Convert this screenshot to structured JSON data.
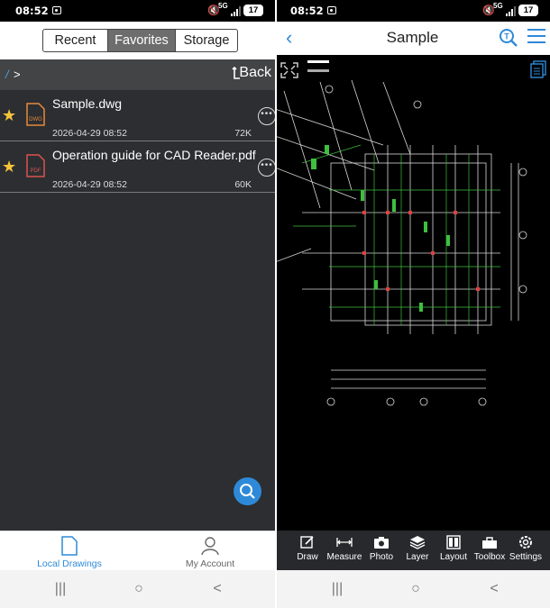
{
  "status": {
    "time": "08:52",
    "network": "5G",
    "battery": "17"
  },
  "left": {
    "tabs": {
      "recent": "Recent",
      "favorites": "Favorites",
      "storage": "Storage"
    },
    "path": {
      "root": "/",
      "separator": ">",
      "back": "Back"
    },
    "files": [
      {
        "name": "Sample.dwg",
        "date": "2026-04-29 08:52",
        "size": "72K",
        "type": "DWG"
      },
      {
        "name": "Operation guide for CAD Reader.pdf",
        "date": "2026-04-29 08:52",
        "size": "60K",
        "type": "PDF"
      }
    ],
    "bottom": {
      "local": "Local Drawings",
      "account": "My Account"
    }
  },
  "right": {
    "title": "Sample",
    "toolbar": [
      "Draw",
      "Measure",
      "Photo",
      "Layer",
      "Layout",
      "Toolbox",
      "Settings"
    ]
  },
  "colors": {
    "accent": "#2e8ad8",
    "star": "#f6c43a",
    "dwg_orange": "#e58a3c",
    "pdf_red": "#d9534f"
  }
}
